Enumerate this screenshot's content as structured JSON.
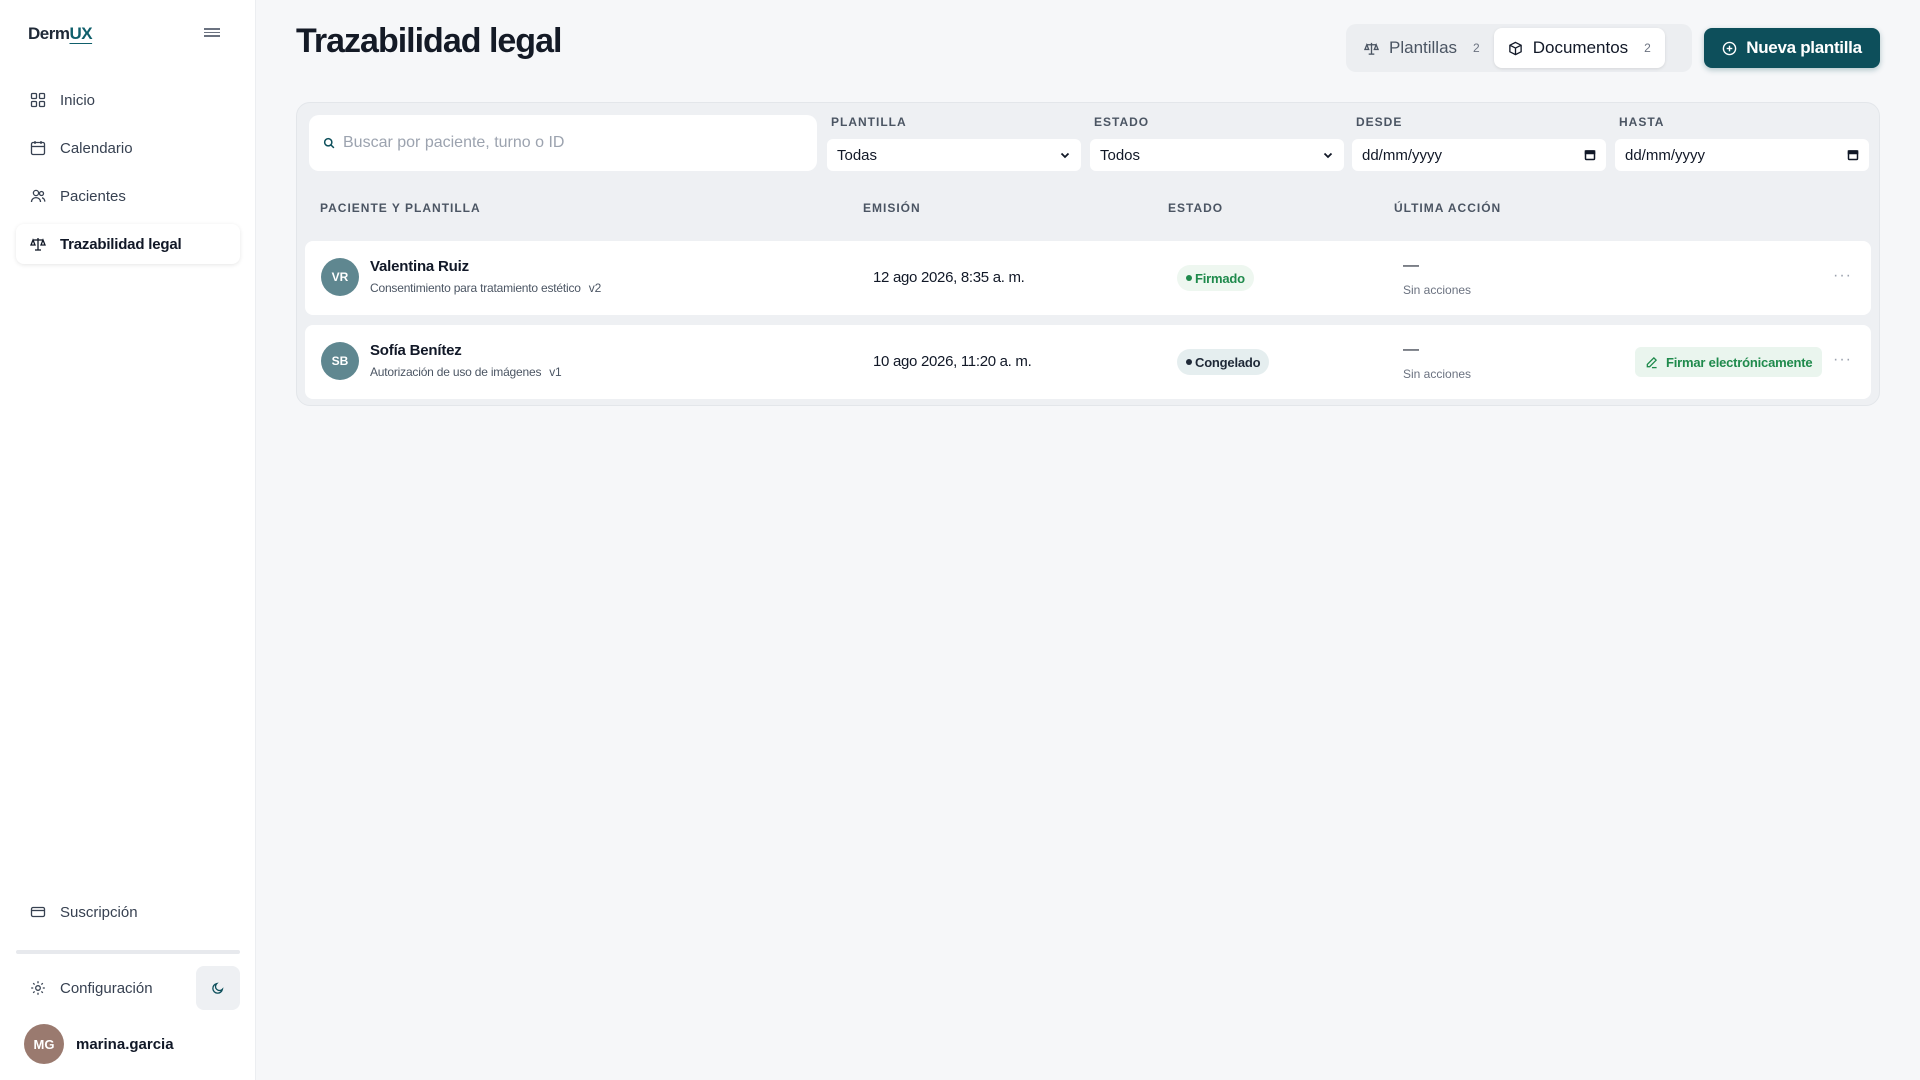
{
  "app": {
    "logo_main": "Derm",
    "logo_accent": "UX"
  },
  "sidebar": {
    "items": [
      {
        "label": "Inicio",
        "icon": "grid-icon"
      },
      {
        "label": "Calendario",
        "icon": "calendar-icon"
      },
      {
        "label": "Pacientes",
        "icon": "users-icon"
      },
      {
        "label": "Trazabilidad legal",
        "icon": "scale-icon",
        "active": true
      }
    ],
    "subscription_label": "Suscripción",
    "settings_label": "Configuración",
    "user": {
      "initials": "MG",
      "name": "marina.garcia"
    }
  },
  "header": {
    "title": "Trazabilidad legal",
    "tabs": [
      {
        "label": "Plantillas",
        "count": "2",
        "icon": "scale-icon"
      },
      {
        "label": "Documentos",
        "count": "2",
        "icon": "box-icon",
        "active": true
      }
    ],
    "new_button_label": "Nueva plantilla"
  },
  "filters": {
    "search_placeholder": "Buscar por paciente, turno o ID",
    "plantilla": {
      "label": "PLANTILLA",
      "value": "Todas"
    },
    "estado": {
      "label": "ESTADO",
      "value": "Todos"
    },
    "desde": {
      "label": "DESDE",
      "value": "dd/mm/yyyy"
    },
    "hasta": {
      "label": "HASTA",
      "value": "dd/mm/yyyy"
    }
  },
  "table": {
    "columns": [
      "PACIENTE Y PLANTILLA",
      "EMISIÓN",
      "ESTADO",
      "ÚLTIMA ACCIÓN"
    ],
    "rows": [
      {
        "initials": "VR",
        "patient": "Valentina Ruiz",
        "template": "Consentimiento para tratamiento estético",
        "version": "v2",
        "issued": "12 ago 2026, 8:35 a. m.",
        "status": "Firmado",
        "last_action": "—",
        "last_action_note": "Sin acciones",
        "more": "···"
      },
      {
        "initials": "SB",
        "patient": "Sofía Benítez",
        "template": "Autorización de uso de imágenes",
        "version": "v1",
        "issued": "10 ago 2026, 11:20 a. m.",
        "status": "Congelado",
        "last_action": "—",
        "last_action_note": "Sin acciones",
        "action_label": "Firmar electrónicamente",
        "more": "···"
      }
    ]
  },
  "colors": {
    "primary": "#0d4f5b",
    "status_signed": "#1f8a4c",
    "status_frozen": "#1f2937",
    "avatar_user": "#9a7a6f",
    "avatar_patient": "#5f8790"
  }
}
